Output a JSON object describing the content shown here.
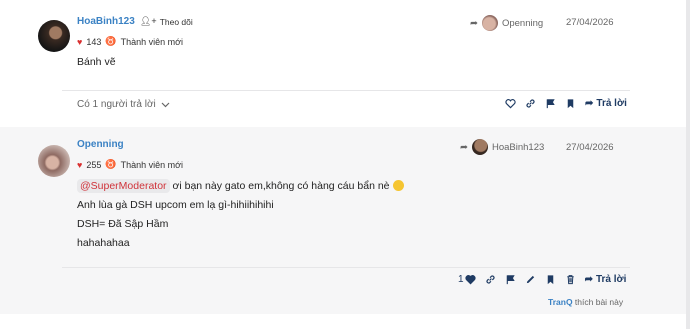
{
  "posts": [
    {
      "username": "HoaBinh123",
      "follow_label": "Theo dõi",
      "likes": "143",
      "rank": "Thành viên mới",
      "reply_to": "Openning",
      "date": "27/04/2026",
      "body": [
        "Bánh vẽ"
      ],
      "replies_toggle": "Có 1 người trả lời",
      "reply_label": "Trả lời",
      "avatar_icon": "user-avatar-dark",
      "reply_to_avatar_icon": "user-avatar-light"
    },
    {
      "username": "Openning",
      "likes": "255",
      "rank": "Thành viên mới",
      "reply_to": "HoaBinh123",
      "date": "27/04/2026",
      "mention": "@SuperModerator",
      "body": [
        " ơi bạn này gato em,không có hàng cáu bẩn nè",
        "Anh lùa gà DSH upcom em lạ gì-hihiihihihi",
        "DSH= Đã Sập Hầm",
        "hahahahaa"
      ],
      "like_count": "1",
      "reply_label": "Trả lời",
      "liked_by_user": "TranQ",
      "liked_by_suffix": " thích bài này",
      "avatar_icon": "user-avatar-light",
      "reply_to_avatar_icon": "user-avatar-dark"
    }
  ],
  "colors": {
    "username": "#3b82c4",
    "heart": "#d93030",
    "mention": "#d0333a",
    "action": "#1f3b63"
  }
}
